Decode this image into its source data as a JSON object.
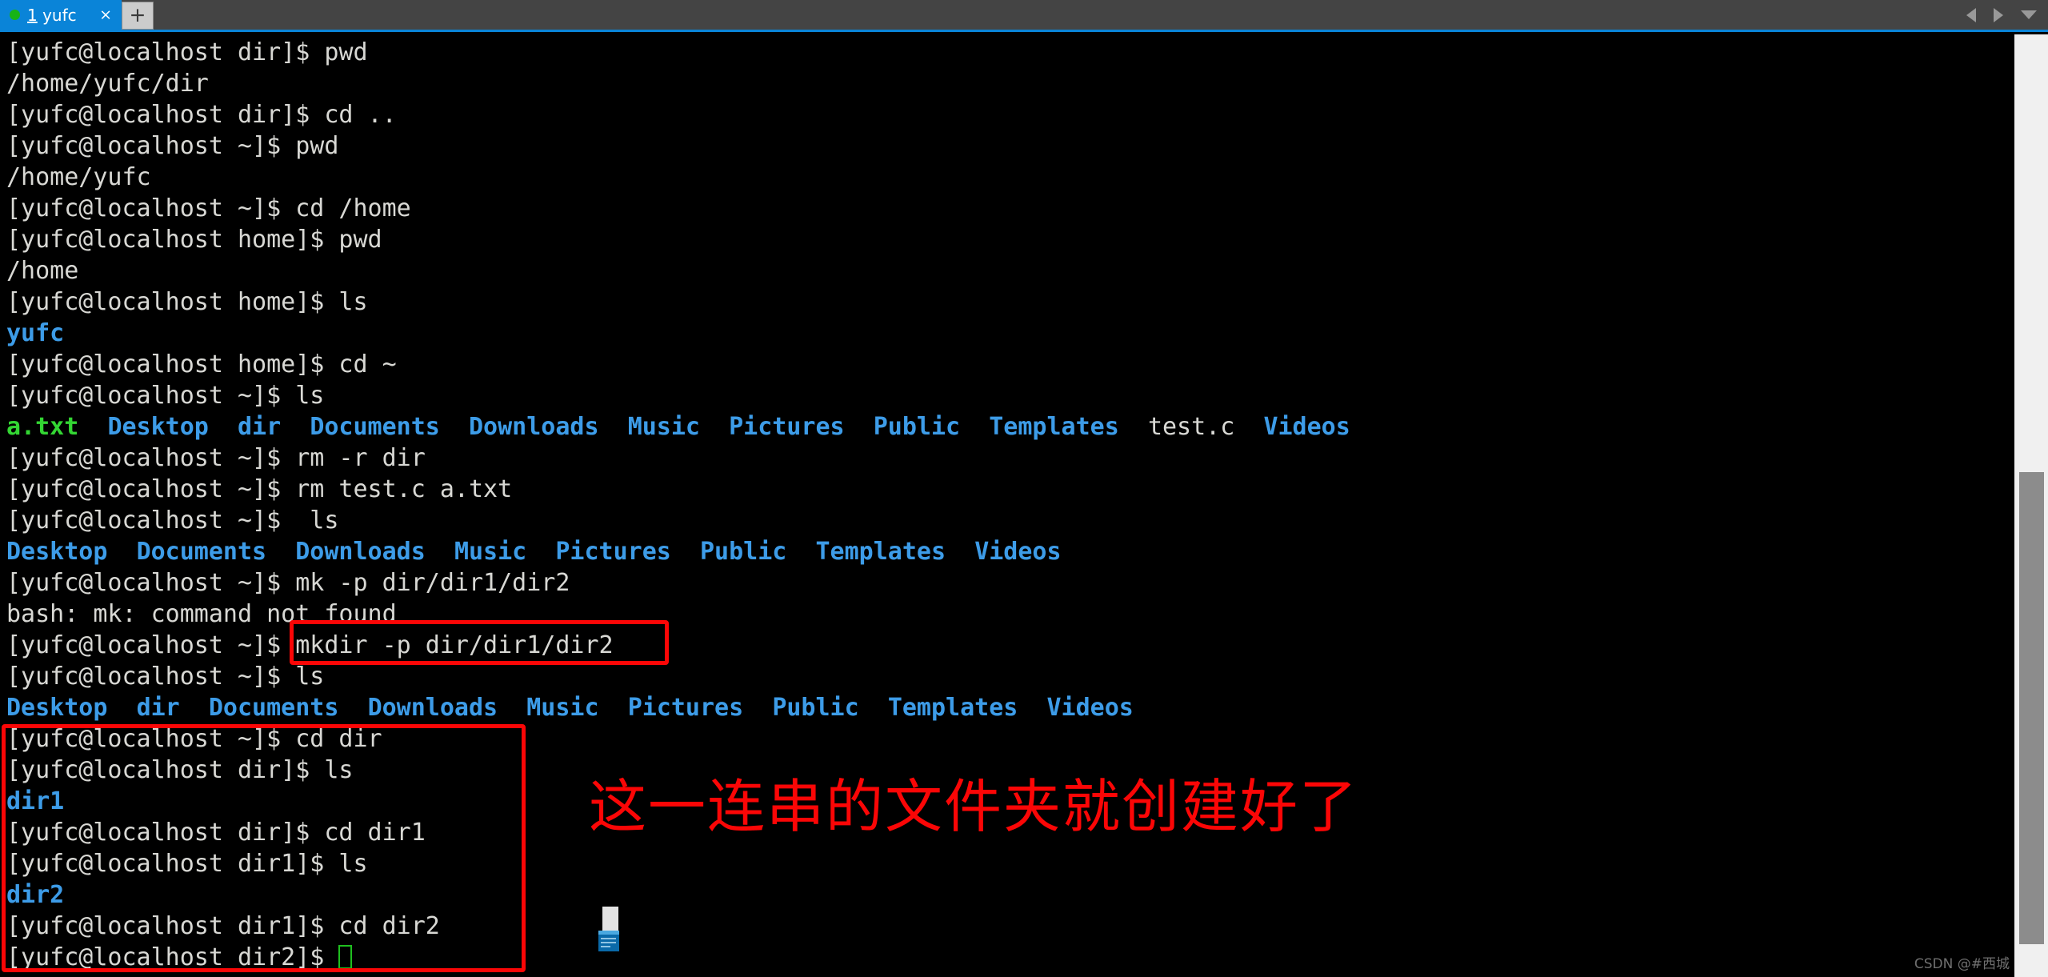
{
  "window": {
    "tab": {
      "status_dot": "green",
      "index": "1",
      "title": "yufc",
      "full_label": "1 yufc",
      "close_glyph": "×"
    },
    "new_tab_glyph": "+",
    "nav": {
      "prev_icon": "triangle-left",
      "next_icon": "triangle-right",
      "menu_icon": "chevron-down"
    }
  },
  "terminal": {
    "background": "#000000",
    "foreground": "#d8d8d4",
    "dir_color": "#3d9ce8",
    "file_color": "#33d633",
    "cursor_color": "#1fbf1f",
    "lines": [
      {
        "id": 0,
        "segments": [
          {
            "text": "[yufc@localhost dir]$ pwd",
            "color": "white"
          }
        ]
      },
      {
        "id": 1,
        "segments": [
          {
            "text": "/home/yufc/dir",
            "color": "white"
          }
        ]
      },
      {
        "id": 2,
        "segments": [
          {
            "text": "[yufc@localhost dir]$ cd ..",
            "color": "white"
          }
        ]
      },
      {
        "id": 3,
        "segments": [
          {
            "text": "[yufc@localhost ~]$ pwd",
            "color": "white"
          }
        ]
      },
      {
        "id": 4,
        "segments": [
          {
            "text": "/home/yufc",
            "color": "white"
          }
        ]
      },
      {
        "id": 5,
        "segments": [
          {
            "text": "[yufc@localhost ~]$ cd /home",
            "color": "white"
          }
        ]
      },
      {
        "id": 6,
        "segments": [
          {
            "text": "[yufc@localhost home]$ pwd",
            "color": "white"
          }
        ]
      },
      {
        "id": 7,
        "segments": [
          {
            "text": "/home",
            "color": "white"
          }
        ]
      },
      {
        "id": 8,
        "segments": [
          {
            "text": "[yufc@localhost home]$ ls",
            "color": "white"
          }
        ]
      },
      {
        "id": 9,
        "segments": [
          {
            "text": "yufc",
            "color": "blue"
          }
        ]
      },
      {
        "id": 10,
        "segments": [
          {
            "text": "[yufc@localhost home]$ cd ~",
            "color": "white"
          }
        ]
      },
      {
        "id": 11,
        "segments": [
          {
            "text": "[yufc@localhost ~]$ ls",
            "color": "white"
          }
        ]
      },
      {
        "id": 12,
        "segments": [
          {
            "text": "a.txt",
            "color": "green"
          },
          {
            "text": "  ",
            "color": "white"
          },
          {
            "text": "Desktop",
            "color": "blue"
          },
          {
            "text": "  ",
            "color": "white"
          },
          {
            "text": "dir",
            "color": "blue"
          },
          {
            "text": "  ",
            "color": "white"
          },
          {
            "text": "Documents",
            "color": "blue"
          },
          {
            "text": "  ",
            "color": "white"
          },
          {
            "text": "Downloads",
            "color": "blue"
          },
          {
            "text": "  ",
            "color": "white"
          },
          {
            "text": "Music",
            "color": "blue"
          },
          {
            "text": "  ",
            "color": "white"
          },
          {
            "text": "Pictures",
            "color": "blue"
          },
          {
            "text": "  ",
            "color": "white"
          },
          {
            "text": "Public",
            "color": "blue"
          },
          {
            "text": "  ",
            "color": "white"
          },
          {
            "text": "Templates",
            "color": "blue"
          },
          {
            "text": "  ",
            "color": "white"
          },
          {
            "text": "test.c",
            "color": "white"
          },
          {
            "text": "  ",
            "color": "white"
          },
          {
            "text": "Videos",
            "color": "blue"
          }
        ]
      },
      {
        "id": 13,
        "segments": [
          {
            "text": "[yufc@localhost ~]$ rm -r dir",
            "color": "white"
          }
        ]
      },
      {
        "id": 14,
        "segments": [
          {
            "text": "[yufc@localhost ~]$ rm test.c a.txt",
            "color": "white"
          }
        ]
      },
      {
        "id": 15,
        "segments": [
          {
            "text": "[yufc@localhost ~]$  ls",
            "color": "white"
          }
        ]
      },
      {
        "id": 16,
        "segments": [
          {
            "text": "Desktop",
            "color": "blue"
          },
          {
            "text": "  ",
            "color": "white"
          },
          {
            "text": "Documents",
            "color": "blue"
          },
          {
            "text": "  ",
            "color": "white"
          },
          {
            "text": "Downloads",
            "color": "blue"
          },
          {
            "text": "  ",
            "color": "white"
          },
          {
            "text": "Music",
            "color": "blue"
          },
          {
            "text": "  ",
            "color": "white"
          },
          {
            "text": "Pictures",
            "color": "blue"
          },
          {
            "text": "  ",
            "color": "white"
          },
          {
            "text": "Public",
            "color": "blue"
          },
          {
            "text": "  ",
            "color": "white"
          },
          {
            "text": "Templates",
            "color": "blue"
          },
          {
            "text": "  ",
            "color": "white"
          },
          {
            "text": "Videos",
            "color": "blue"
          }
        ]
      },
      {
        "id": 17,
        "segments": [
          {
            "text": "[yufc@localhost ~]$ mk -p dir/dir1/dir2",
            "color": "white"
          }
        ]
      },
      {
        "id": 18,
        "segments": [
          {
            "text": "bash: mk: command not found",
            "color": "white"
          }
        ]
      },
      {
        "id": 19,
        "segments": [
          {
            "text": "[yufc@localhost ~]$ mkdir -p dir/dir1/dir2",
            "color": "white"
          }
        ]
      },
      {
        "id": 20,
        "segments": [
          {
            "text": "[yufc@localhost ~]$ ls",
            "color": "white"
          }
        ]
      },
      {
        "id": 21,
        "segments": [
          {
            "text": "Desktop",
            "color": "blue"
          },
          {
            "text": "  ",
            "color": "white"
          },
          {
            "text": "dir",
            "color": "blue"
          },
          {
            "text": "  ",
            "color": "white"
          },
          {
            "text": "Documents",
            "color": "blue"
          },
          {
            "text": "  ",
            "color": "white"
          },
          {
            "text": "Downloads",
            "color": "blue"
          },
          {
            "text": "  ",
            "color": "white"
          },
          {
            "text": "Music",
            "color": "blue"
          },
          {
            "text": "  ",
            "color": "white"
          },
          {
            "text": "Pictures",
            "color": "blue"
          },
          {
            "text": "  ",
            "color": "white"
          },
          {
            "text": "Public",
            "color": "blue"
          },
          {
            "text": "  ",
            "color": "white"
          },
          {
            "text": "Templates",
            "color": "blue"
          },
          {
            "text": "  ",
            "color": "white"
          },
          {
            "text": "Videos",
            "color": "blue"
          }
        ]
      },
      {
        "id": 22,
        "segments": [
          {
            "text": "[yufc@localhost ~]$ cd dir",
            "color": "white"
          }
        ]
      },
      {
        "id": 23,
        "segments": [
          {
            "text": "[yufc@localhost dir]$ ls",
            "color": "white"
          }
        ]
      },
      {
        "id": 24,
        "segments": [
          {
            "text": "dir1",
            "color": "blue"
          }
        ]
      },
      {
        "id": 25,
        "segments": [
          {
            "text": "[yufc@localhost dir]$ cd dir1",
            "color": "white"
          }
        ]
      },
      {
        "id": 26,
        "segments": [
          {
            "text": "[yufc@localhost dir1]$ ls",
            "color": "white"
          }
        ]
      },
      {
        "id": 27,
        "segments": [
          {
            "text": "dir2",
            "color": "blue"
          }
        ]
      },
      {
        "id": 28,
        "segments": [
          {
            "text": "[yufc@localhost dir1]$ cd dir2",
            "color": "white"
          }
        ]
      },
      {
        "id": 29,
        "segments": [
          {
            "text": "[yufc@localhost dir2]$ ",
            "color": "white"
          }
        ],
        "cursor": true
      }
    ]
  },
  "annotations": {
    "color": "#fb0606",
    "mkdir_highlight_target": "mkdir -p dir/dir1/dir2",
    "chain_highlight_target": "cd dir / ls / dir1 / cd dir1 / ls / dir2 / cd dir2",
    "note_text": "这一连串的文件夹就创建好了"
  },
  "scrollbar": {
    "track_color": "#f0f0f0",
    "thumb_color": "#8c8c8c"
  },
  "watermark": {
    "text": "CSDN @#西城"
  }
}
